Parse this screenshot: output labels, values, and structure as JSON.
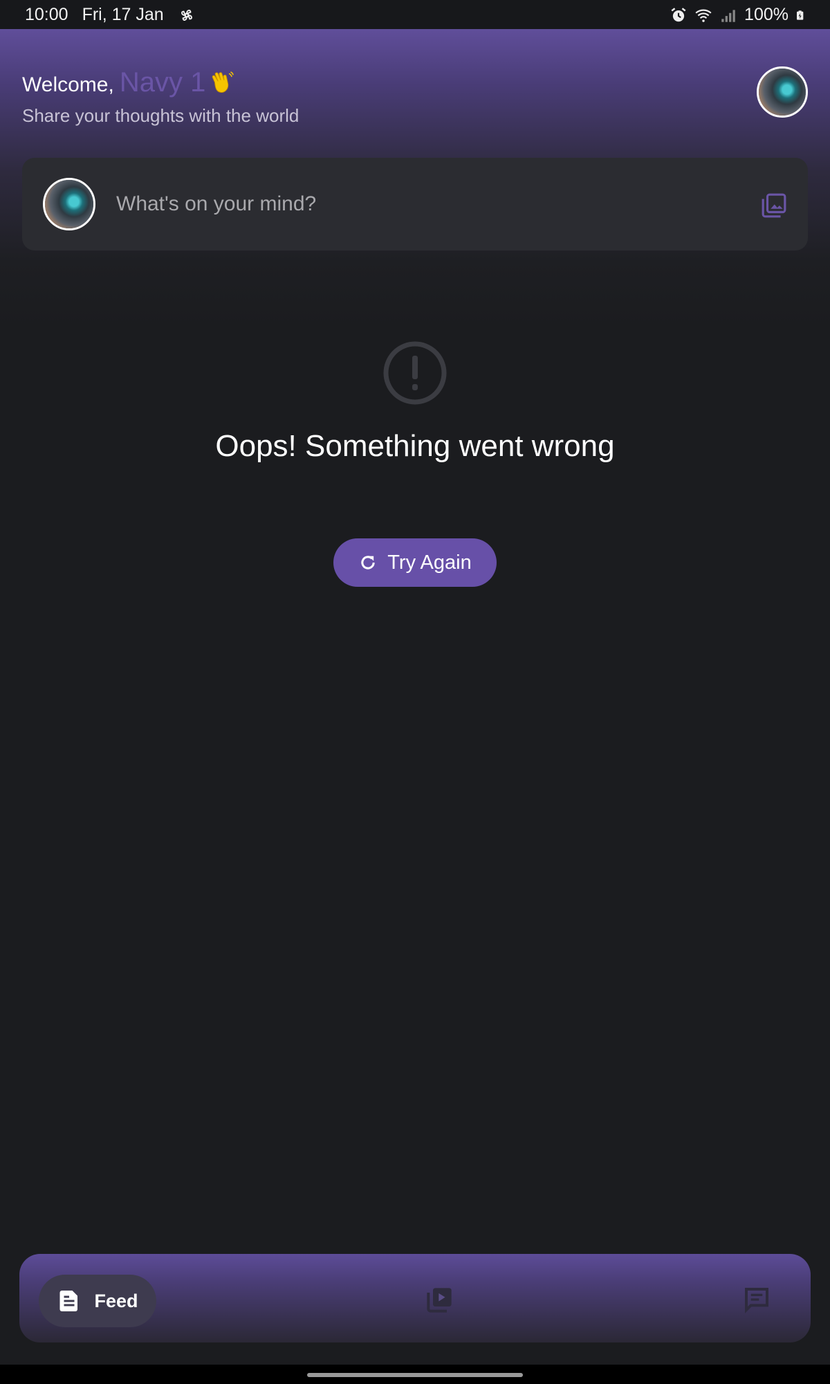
{
  "status_bar": {
    "time": "10:00",
    "date": "Fri, 17 Jan",
    "battery": "100%",
    "icons": [
      "pinwheel-icon",
      "alarm-icon",
      "wifi-icon",
      "signal-icon",
      "battery-charging-icon"
    ]
  },
  "header": {
    "welcome_prefix": "Welcome,",
    "user_name": "Navy 1",
    "subtitle": "Share your thoughts with the world",
    "wave_icon": "waving-hand-icon",
    "avatar_icon": "user-avatar"
  },
  "composer": {
    "placeholder": "What's on your mind?",
    "media_icon": "photo-gallery-icon"
  },
  "error": {
    "icon": "error-circle-icon",
    "title": "Oops! Something went wrong",
    "retry_label": "Try Again",
    "retry_icon": "refresh-icon"
  },
  "bottom_nav": {
    "items": [
      {
        "label": "Feed",
        "icon": "document-icon",
        "active": true
      },
      {
        "label": "",
        "icon": "video-library-icon",
        "active": false
      },
      {
        "label": "",
        "icon": "chat-icon",
        "active": false
      }
    ]
  },
  "colors": {
    "accent": "#6750a8",
    "name_color": "#6a55a6",
    "background": "#1b1c1f",
    "card": "#2b2c31",
    "wave_yellow": "#f5c400"
  }
}
